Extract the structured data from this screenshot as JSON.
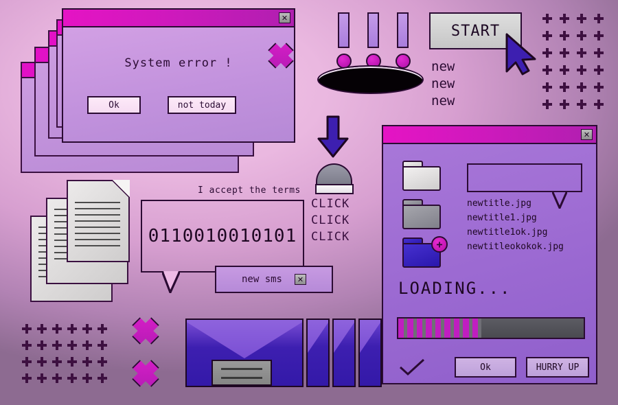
{
  "background": {
    "gradient_from": "#f0c0e6",
    "gradient_to": "#8e6c92"
  },
  "error_window": {
    "title_bar_color": "#e514c4",
    "close_label": "✕",
    "message": "System error !",
    "buttons": [
      {
        "label": "Ok"
      },
      {
        "label": "not today"
      }
    ],
    "stack_count": 4
  },
  "exclamations": {
    "count": 3
  },
  "start_button": {
    "label": "START"
  },
  "cursor": {
    "icon": "arrow-cursor-icon",
    "color": "#3d1fb0"
  },
  "new_list": {
    "items": [
      "new",
      "new",
      "new"
    ]
  },
  "plus_grid_top_right": {
    "columns": 4,
    "rows": 6
  },
  "plus_grid_bottom_left": {
    "columns": 6,
    "rows": 4
  },
  "down_arrow": {
    "icon": "down-arrow-icon",
    "color": "#3d1fb0"
  },
  "dome_button": {
    "icon": "dome-button-icon"
  },
  "click_text": {
    "lines": [
      "CLICK",
      "CLICK",
      "CLICK"
    ]
  },
  "documents": {
    "count": 3
  },
  "terms": {
    "label": "I accept the terms"
  },
  "speech_bubble": {
    "text": "0110010010101"
  },
  "sms_box": {
    "label": "new sms",
    "close_label": "✕"
  },
  "envelopes": {
    "count": 4
  },
  "x_crosses": {
    "count": 3,
    "color": "#c01ec0"
  },
  "loading_window": {
    "title_bar_color": "#cf19bd",
    "close_label": "✕",
    "folders": [
      {
        "name": "folder-white",
        "badge": null
      },
      {
        "name": "folder-gray",
        "badge": null
      },
      {
        "name": "folder-blue",
        "badge": "+"
      }
    ],
    "files": [
      "newtitle.jpg",
      "newtitle1.jpg",
      "newtitle1ok.jpg",
      "newtitleokokok.jpg"
    ],
    "loading_label": "LOADING...",
    "progress": {
      "percent": 45,
      "segment_count": 9,
      "fill_color": "#c01ec0",
      "track_color": "#4a4a50"
    },
    "check_icon": "checkmark-icon",
    "buttons": [
      {
        "label": "Ok"
      },
      {
        "label": "HURRY UP"
      }
    ]
  }
}
